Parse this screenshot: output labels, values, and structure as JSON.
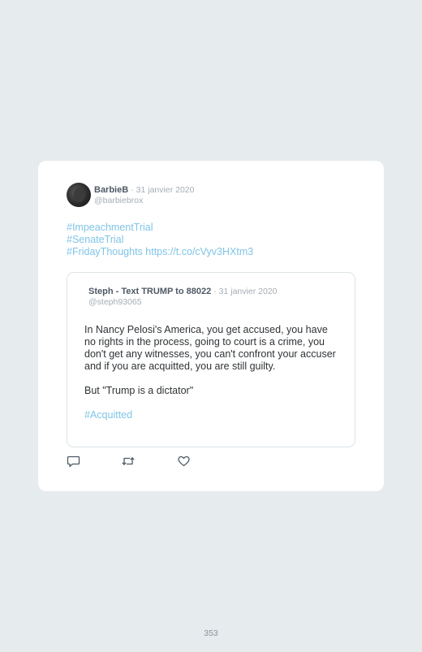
{
  "tweet": {
    "author_name": "BarbieB",
    "date": "· 31 janvier 2020",
    "handle": "@barbiebrox",
    "lines": [
      "#ImpeachmentTrial",
      "#SenateTrial",
      "#FridayThoughts https://t.co/cVyv3HXtm3"
    ]
  },
  "quoted": {
    "author_name": "Steph - Text TRUMP to 88022",
    "date": "· 31 janvier 2020",
    "handle": "@steph93065",
    "paragraph1": "In Nancy Pelosi's America, you get accused, you have no rights in the process, going to court is a crime, you don't get any witnesses, you can't confront your accuser and if you are acquitted, you are still guilty.",
    "paragraph2": "But \"Trump is a dictator\"",
    "hashtag": "#Acquitted"
  },
  "actions": {
    "icons": [
      "reply-icon",
      "retweet-icon",
      "like-icon"
    ]
  },
  "footer": {
    "page_number": "353"
  },
  "colors": {
    "background": "#e6ebee",
    "card": "#ffffff",
    "link": "#7fc4e6",
    "name": "#4e5965",
    "muted": "#a5adb5",
    "body_text": "#2f3336"
  }
}
